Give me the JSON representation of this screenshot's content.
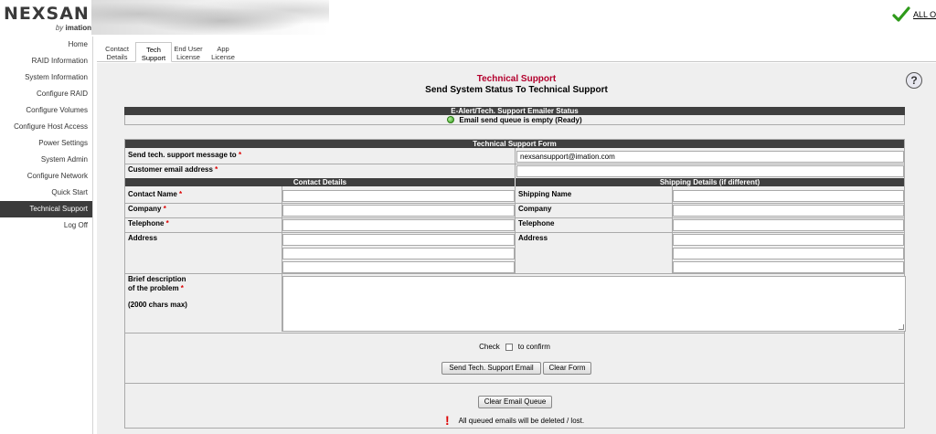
{
  "header": {
    "logo_main": "NEXSAN",
    "logo_by": "by",
    "logo_brand": "imation",
    "status_label": "ALL O",
    "status_icon": "checkmark-icon",
    "status_color": "#2e9a1a"
  },
  "sidebar": {
    "items": [
      {
        "label": "Home",
        "active": false
      },
      {
        "label": "RAID Information",
        "active": false
      },
      {
        "label": "System Information",
        "active": false
      },
      {
        "label": "Configure RAID",
        "active": false
      },
      {
        "label": "Configure Volumes",
        "active": false
      },
      {
        "label": "Configure Host Access",
        "active": false
      },
      {
        "label": "Power Settings",
        "active": false
      },
      {
        "label": "System Admin",
        "active": false
      },
      {
        "label": "Configure Network",
        "active": false
      },
      {
        "label": "Quick Start",
        "active": false
      },
      {
        "label": "Technical Support",
        "active": true
      },
      {
        "label": "Log Off",
        "active": false
      }
    ]
  },
  "tabs": [
    {
      "line1": "Contact",
      "line2": "Details",
      "active": false
    },
    {
      "line1": "Tech",
      "line2": "Support",
      "active": true
    },
    {
      "line1": "End User",
      "line2": "License",
      "active": false
    },
    {
      "line1": "App",
      "line2": "License",
      "active": false
    }
  ],
  "page": {
    "title": "Technical Support",
    "subtitle": "Send System Status To Technical Support",
    "title_color": "#b3002d",
    "help_icon": "question-mark-icon",
    "help_glyph": "?"
  },
  "emailer": {
    "header": "E-Alert/Tech. Support Emailer Status",
    "status": "Email send queue is empty (Ready)",
    "status_color": "#2f9a18"
  },
  "form": {
    "header": "Technical Support Form",
    "send_to_label": "Send tech. support message to",
    "send_to_value": "nexsansupport@imation.com",
    "customer_email_label": "Customer email address",
    "customer_email_value": "",
    "contact_header": "Contact Details",
    "shipping_header": "Shipping Details (if different)",
    "contact_name_label": "Contact Name",
    "company_label": "Company",
    "telephone_label": "Telephone",
    "address_label": "Address",
    "shipping_name_label": "Shipping Name",
    "shipping_company_label": "Company",
    "shipping_telephone_label": "Telephone",
    "shipping_address_label": "Address",
    "description_line1": "Brief description",
    "description_line2": "of the problem",
    "description_max": "(2000 chars max)",
    "required_marker": "*",
    "check_label": "Check",
    "confirm_label": "to confirm",
    "send_button": "Send Tech. Support Email",
    "clear_form_button": "Clear Form",
    "clear_queue_button": "Clear Email Queue",
    "warning_text": "All queued emails will be deleted / lost.",
    "warning_glyph": "!"
  }
}
